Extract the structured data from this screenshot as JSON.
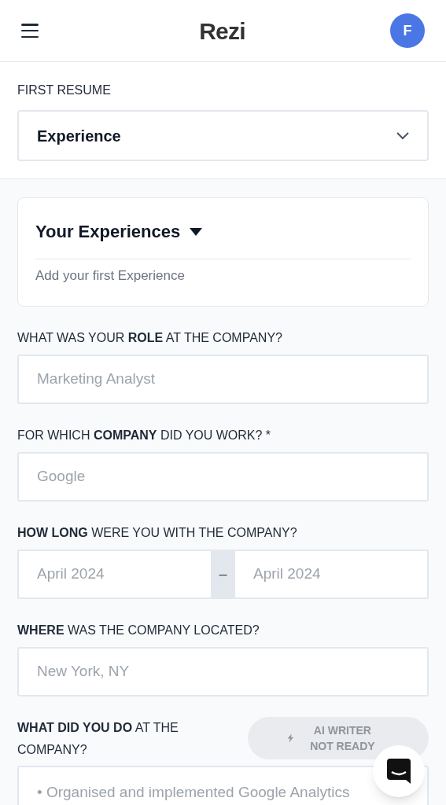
{
  "header": {
    "logo": "Rezi",
    "avatar": "F"
  },
  "resume": {
    "label": "FIRST RESUME",
    "section": "Experience"
  },
  "experiences": {
    "title": "Your Experiences",
    "expanded": true,
    "hint": "Add your first Experience"
  },
  "fields": [
    {
      "kind": "text",
      "label": "WHAT WAS YOUR **ROLE** AT THE COMPANY?",
      "placeholder": "Marketing Analyst"
    },
    {
      "kind": "text",
      "label": "FOR WHICH **COMPANY** DID YOU WORK? *",
      "placeholder": "Google"
    },
    {
      "kind": "range",
      "label": "**HOW LONG** WERE YOU WITH THE COMPANY?",
      "start_placeholder": "April 2024",
      "separator": "–",
      "end_placeholder": "April 2024"
    },
    {
      "kind": "text",
      "label": "**WHERE** WAS THE COMPANY LOCATED?",
      "placeholder": "New York, NY"
    },
    {
      "kind": "textarea",
      "label": "**WHAT DID YOU DO** AT THE COMPANY?",
      "placeholder": "• Organised and implemented Google Analytics",
      "ai_button": {
        "label": "AI WRITER NOT READY",
        "disabled": true
      }
    }
  ]
}
